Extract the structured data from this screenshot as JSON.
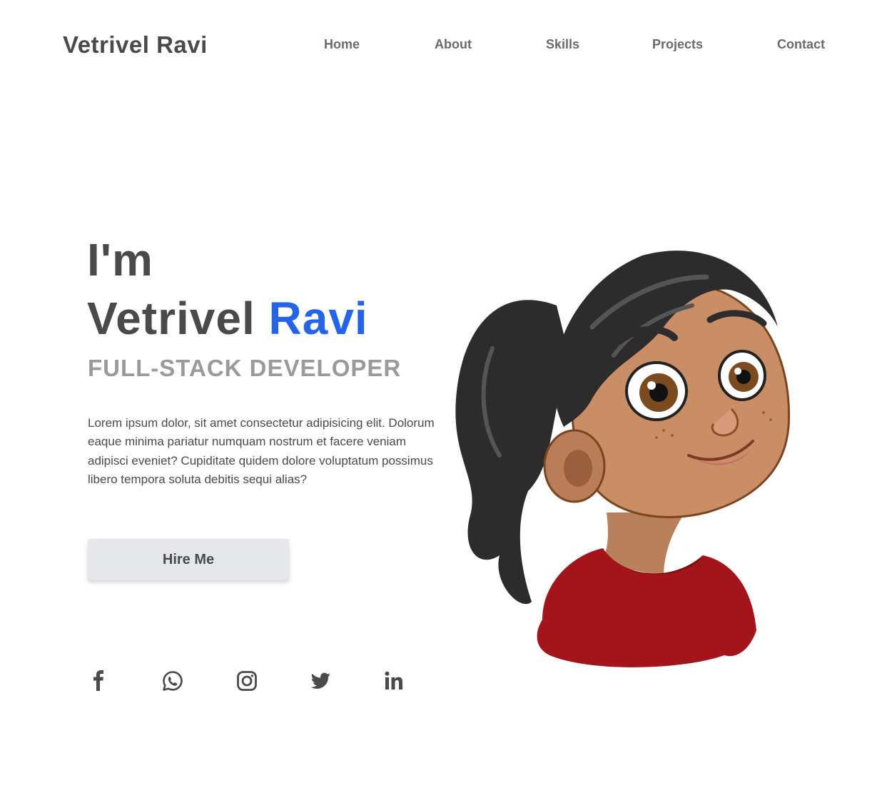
{
  "header": {
    "logo": "Vetrivel Ravi",
    "nav": [
      "Home",
      "About",
      "Skills",
      "Projects",
      "Contact"
    ]
  },
  "hero": {
    "greeting": "I'm",
    "first_name": "Vetrivel",
    "last_name": "Ravi",
    "role": "FULL-STACK DEVELOPER",
    "bio": "Lorem ipsum dolor, sit amet consectetur adipisicing elit. Dolorum eaque minima pariatur numquam nostrum et facere veniam adipisci eveniet? Cupiditate quidem dolore voluptatum possimus libero tempora soluta debitis sequi alias?",
    "cta": "Hire Me"
  },
  "social": [
    "facebook-icon",
    "whatsapp-icon",
    "instagram-icon",
    "twitter-icon",
    "linkedin-icon"
  ],
  "colors": {
    "accent": "#2563eb",
    "text": "#4a4a4a",
    "muted": "#9a9a9a",
    "button_bg": "#e5e7eb"
  }
}
